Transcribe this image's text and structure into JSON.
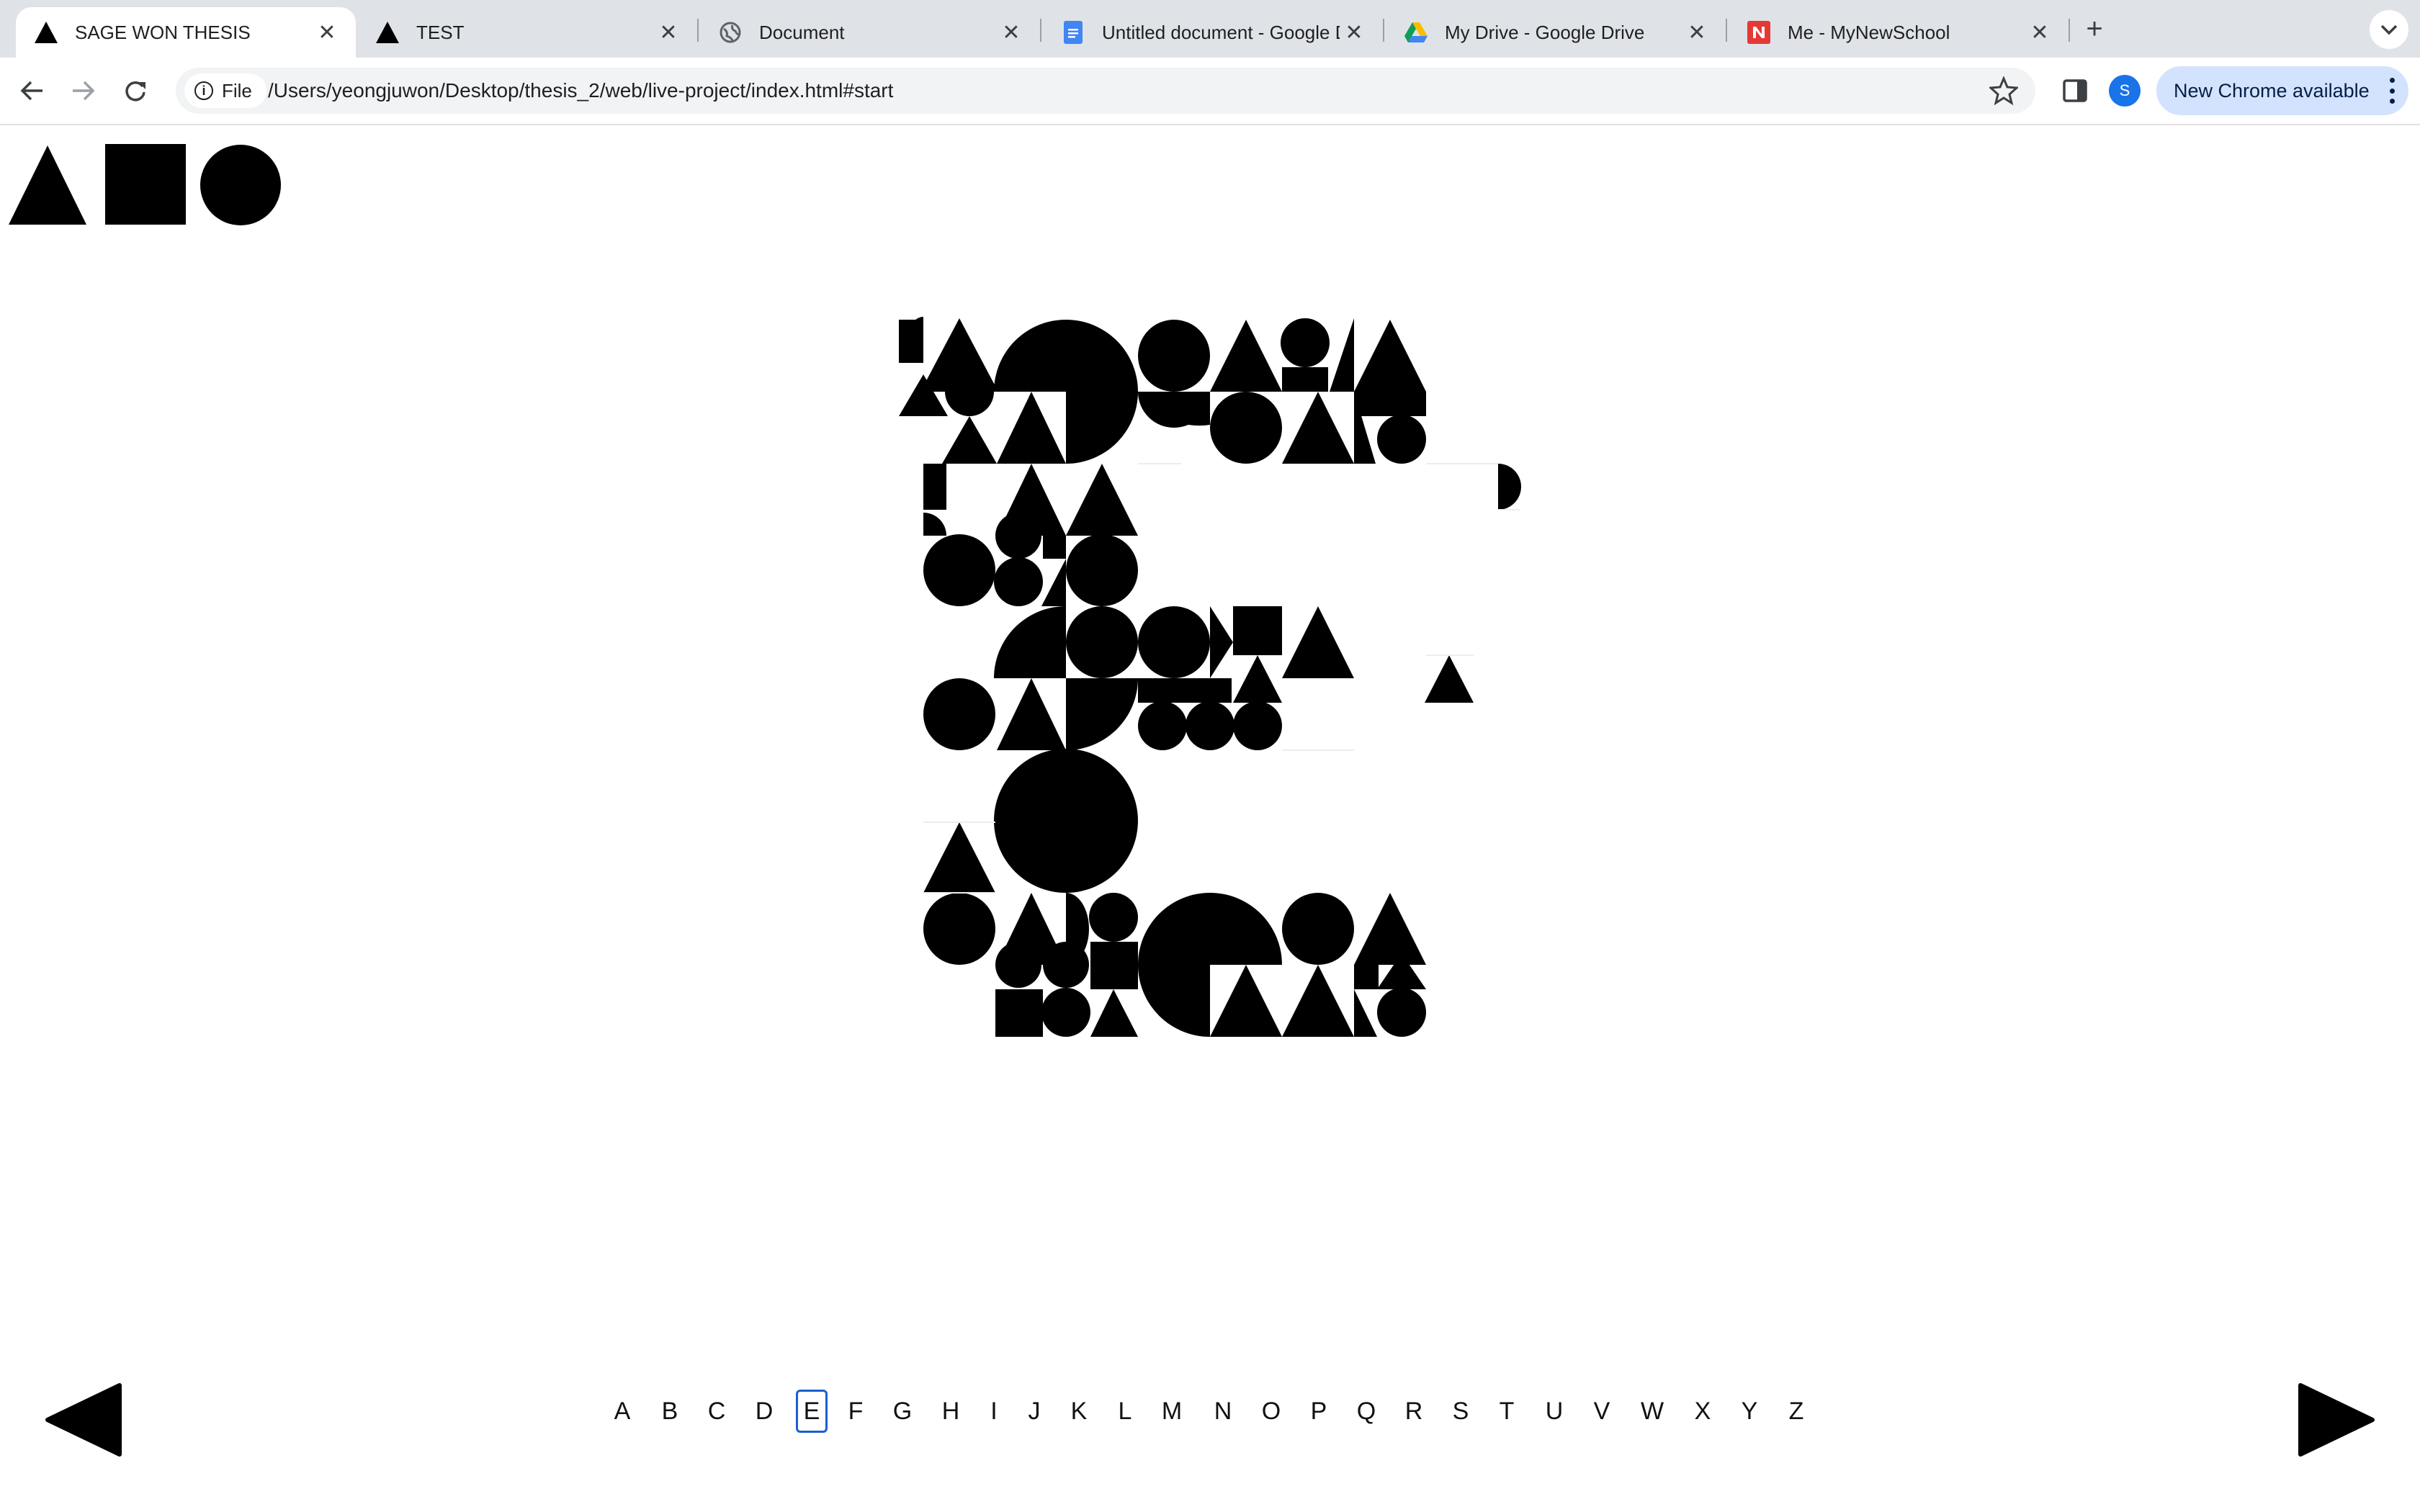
{
  "browser": {
    "tabs": [
      {
        "title": "SAGE WON THESIS",
        "favicon": "triangle-icon",
        "active": true
      },
      {
        "title": "TEST",
        "favicon": "triangle-icon",
        "active": false
      },
      {
        "title": "Document",
        "favicon": "globe-icon",
        "active": false
      },
      {
        "title": "Untitled document - Google D",
        "favicon": "google-docs-icon",
        "active": false
      },
      {
        "title": "My Drive - Google Drive",
        "favicon": "google-drive-icon",
        "active": false
      },
      {
        "title": "Me - MyNewSchool",
        "favicon": "newschool-icon",
        "active": false
      }
    ],
    "site_chip": "File",
    "url": "/Users/yeongjuwon/Desktop/thesis_2/web/live-project/index.html#start",
    "profile_initial": "S",
    "update_label": "New Chrome available",
    "accent_color": "#1a73e8",
    "update_bg": "#d3e3fd"
  },
  "page": {
    "logo_icons": [
      "triangle-icon",
      "square-icon",
      "circle-icon"
    ],
    "current_letter": "E",
    "alphabet": [
      "A",
      "B",
      "C",
      "D",
      "E",
      "F",
      "G",
      "H",
      "I",
      "J",
      "K",
      "L",
      "M",
      "N",
      "O",
      "P",
      "Q",
      "R",
      "S",
      "T",
      "U",
      "V",
      "W",
      "X",
      "Y",
      "Z"
    ],
    "selected_color": "#1a5fd0",
    "prev_icon": "left-arrow-icon",
    "next_icon": "right-arrow-icon"
  }
}
